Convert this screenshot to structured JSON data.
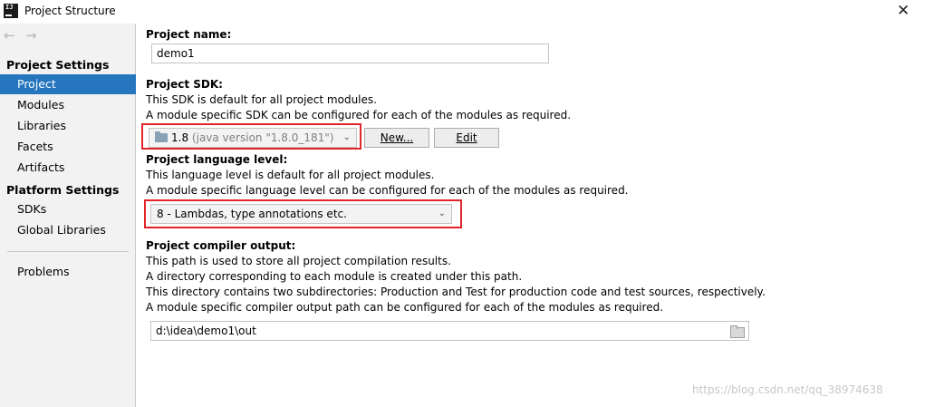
{
  "window": {
    "title": "Project Structure",
    "app_icon_text": "IJ",
    "close_glyph": "✕"
  },
  "sidebar": {
    "back_glyph": "←",
    "forward_glyph": "→",
    "project_settings_header": "Project Settings",
    "project_settings_items": [
      {
        "label": "Project",
        "selected": true
      },
      {
        "label": "Modules",
        "selected": false
      },
      {
        "label": "Libraries",
        "selected": false
      },
      {
        "label": "Facets",
        "selected": false
      },
      {
        "label": "Artifacts",
        "selected": false
      }
    ],
    "platform_settings_header": "Platform Settings",
    "platform_settings_items": [
      {
        "label": "SDKs"
      },
      {
        "label": "Global Libraries"
      }
    ],
    "problems_label": "Problems"
  },
  "project_name": {
    "label": "Project name:",
    "value": "demo1"
  },
  "project_sdk": {
    "label": "Project SDK:",
    "desc1": "This SDK is default for all project modules.",
    "desc2": "A module specific SDK can be configured for each of the modules as required.",
    "selected_version": "1.8",
    "selected_detail": "(java version \"1.8.0_181\")",
    "new_button": "New...",
    "edit_button": "Edit"
  },
  "language_level": {
    "label": "Project language level:",
    "desc1": "This language level is default for all project modules.",
    "desc2": "A module specific language level can be configured for each of the modules as required.",
    "selected": "8 - Lambdas, type annotations etc."
  },
  "compiler_output": {
    "label": "Project compiler output:",
    "desc1": "This path is used to store all project compilation results.",
    "desc2": "A directory corresponding to each module is created under this path.",
    "desc3": "This directory contains two subdirectories: Production and Test for production code and test sources, respectively.",
    "desc4": "A module specific compiler output path can be configured for each of the modules as required.",
    "path": "d:\\idea\\demo1\\out"
  },
  "watermark": "https://blog.csdn.net/qq_38974638",
  "colors": {
    "selection": "#2675bf",
    "highlight_border": "#e0262c",
    "sidebar_bg": "#f2f2f2"
  }
}
